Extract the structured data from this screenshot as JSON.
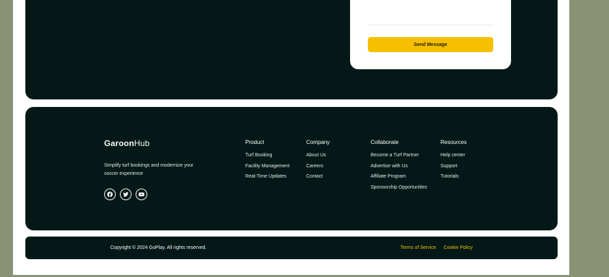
{
  "contact_form": {
    "send_label": "Send Message"
  },
  "footer": {
    "logo_bold": "Garoon",
    "logo_light": "Hub",
    "tagline": "Simplify turf bookings and modernize your soccer experience",
    "socials": [
      {
        "icon": "facebook-icon"
      },
      {
        "icon": "twitter-icon"
      },
      {
        "icon": "youtube-icon"
      }
    ],
    "columns": [
      {
        "title": "Product",
        "links": [
          "Turf Booking",
          "Facility Management",
          "Real-Time Updates"
        ]
      },
      {
        "title": "Company",
        "links": [
          "About Us",
          "Careers",
          "Contact"
        ]
      },
      {
        "title": "Collaborate",
        "links": [
          "Become a Turf Partner",
          "Advertise with Us",
          "Affiliate Program",
          "Sponsorship Opportunities"
        ]
      },
      {
        "title": "Resources",
        "links": [
          "Help center",
          "Support",
          "Tutorials"
        ]
      }
    ]
  },
  "bottom_bar": {
    "copyright": "Copyright © 2024 GoPlay. All rights reserved.",
    "terms": "Terms of Service",
    "cookie": "Cookie Policy"
  },
  "colors": {
    "panel": "#031817",
    "accent": "#f6c000",
    "backdrop": "#8a9276"
  }
}
